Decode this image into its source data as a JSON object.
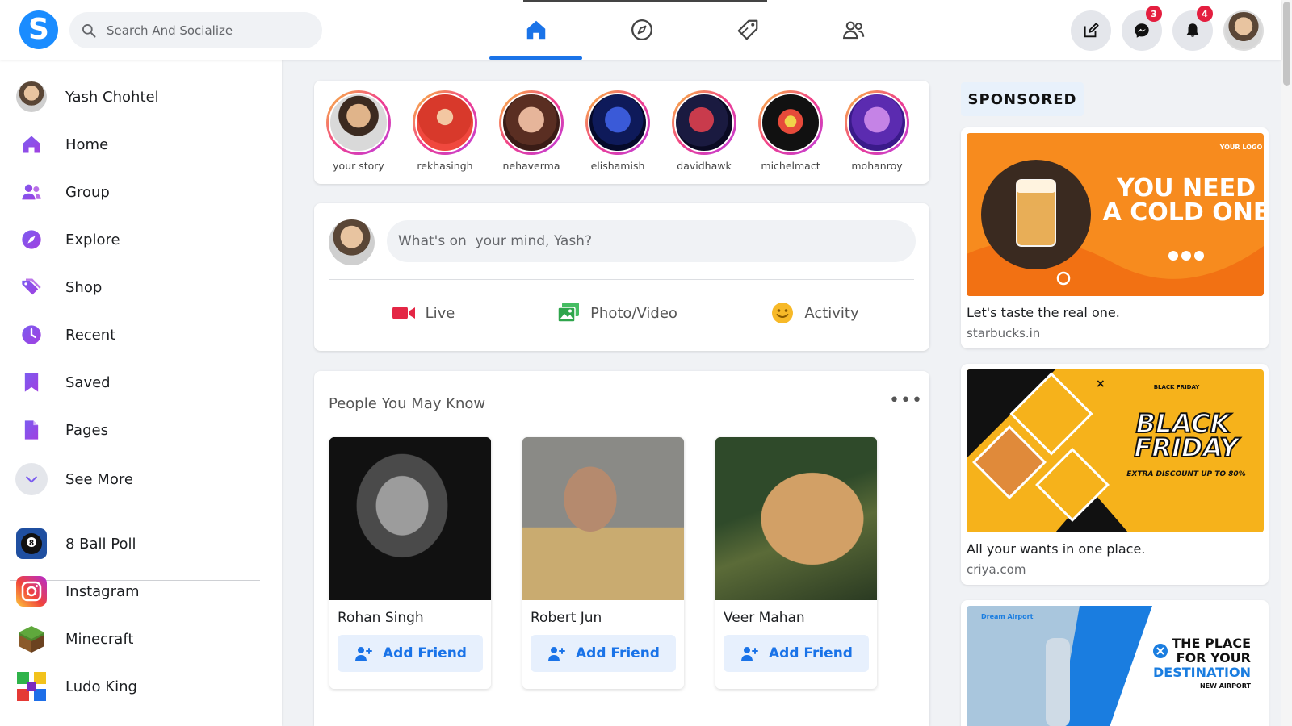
{
  "app": {
    "logo_letter": "S",
    "brand_color": "#1a8cff"
  },
  "search": {
    "placeholder": "Search And Socialize"
  },
  "nav": {
    "tabs": [
      {
        "icon": "home-icon",
        "active": true
      },
      {
        "icon": "compass-icon",
        "active": false
      },
      {
        "icon": "tag-icon",
        "active": false
      },
      {
        "icon": "people-icon",
        "active": false
      }
    ]
  },
  "actions": {
    "messenger_badge": "3",
    "notifications_badge": "4"
  },
  "sidebar": {
    "profile_name": "Yash Chohtel",
    "items": [
      {
        "label": "Home",
        "icon": "home-icon"
      },
      {
        "label": "Group",
        "icon": "group-icon"
      },
      {
        "label": "Explore",
        "icon": "explore-icon"
      },
      {
        "label": "Shop",
        "icon": "shop-tag-icon"
      },
      {
        "label": "Recent",
        "icon": "clock-icon"
      },
      {
        "label": "Saved",
        "icon": "bookmark-icon"
      },
      {
        "label": "Pages",
        "icon": "page-icon"
      }
    ],
    "see_more": "See More",
    "apps": [
      {
        "label": "8 Ball Poll",
        "icon": "8-ball-icon"
      },
      {
        "label": "Instagram",
        "icon": "instagram-icon"
      },
      {
        "label": "Minecraft",
        "icon": "minecraft-icon"
      },
      {
        "label": "Ludo King",
        "icon": "ludo-icon"
      }
    ]
  },
  "stories": [
    {
      "name": "your story"
    },
    {
      "name": "rekhasingh"
    },
    {
      "name": "nehaverma"
    },
    {
      "name": "elishamish"
    },
    {
      "name": "davidhawk"
    },
    {
      "name": "michelmact"
    },
    {
      "name": "mohanroy"
    }
  ],
  "composer": {
    "placeholder": "What's on  your mind, Yash?",
    "buttons": {
      "live": "Live",
      "photo": "Photo/Video",
      "activity": "Activity"
    }
  },
  "people": {
    "title": "People You May Know",
    "more": "•••",
    "cards": [
      {
        "name": "Rohan Singh",
        "action": "Add Friend"
      },
      {
        "name": "Robert Jun",
        "action": "Add Friend"
      },
      {
        "name": "Veer Mahan",
        "action": "Add Friend"
      }
    ]
  },
  "sponsored": {
    "label": "SPONSORED",
    "ads": [
      {
        "headline_line1": "YOU NEED",
        "headline_line2": "A COLD ONE",
        "logo_text": "YOUR LOGO",
        "text": "Let's taste the real one.",
        "url": "starbucks.in"
      },
      {
        "headline_line1": "BLACK",
        "headline_line2": "FRIDAY",
        "tagline": "EXTRA DISCOUNT UP TO 80%",
        "badge": "BLACK FRIDAY",
        "text": "All your wants in one place.",
        "url": "criya.com"
      },
      {
        "brand": "Dream Airport",
        "headline_line1": "THE PLACE",
        "headline_line2": "FOR YOUR",
        "headline_line3": "DESTINATION",
        "sub": "NEW AIRPORT"
      }
    ]
  }
}
